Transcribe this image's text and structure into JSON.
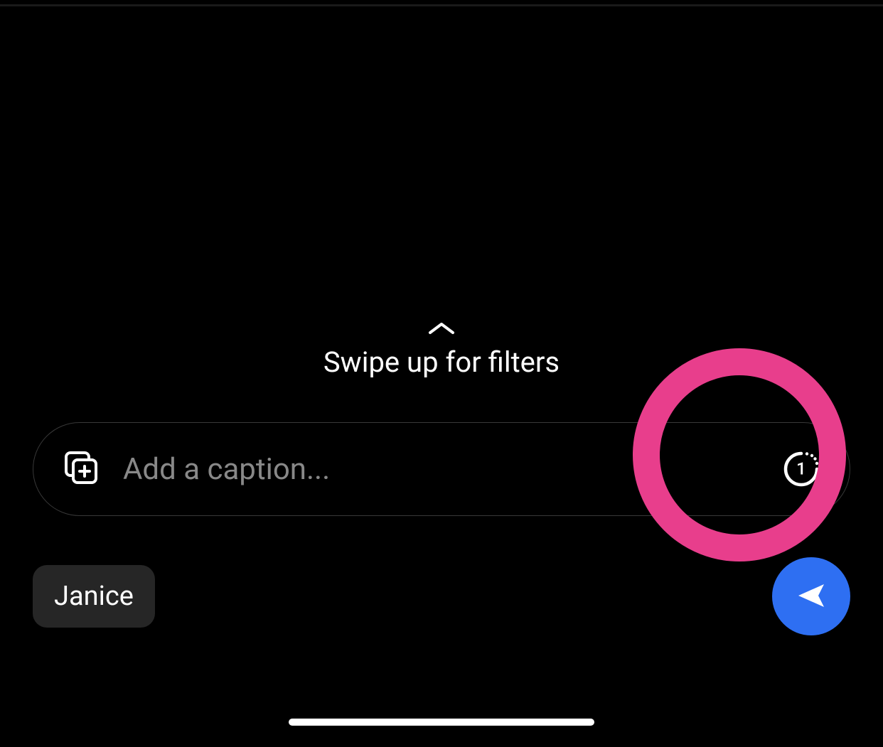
{
  "filters_hint": {
    "label": "Swipe up for filters"
  },
  "caption": {
    "placeholder": "Add a caption...",
    "value": "",
    "view_once_count": "1"
  },
  "recipient": {
    "name": "Janice"
  },
  "colors": {
    "accent": "#2e6ff2",
    "highlight_annotation": "#e83e8c",
    "chip_bg": "#262626",
    "border": "#383838"
  }
}
